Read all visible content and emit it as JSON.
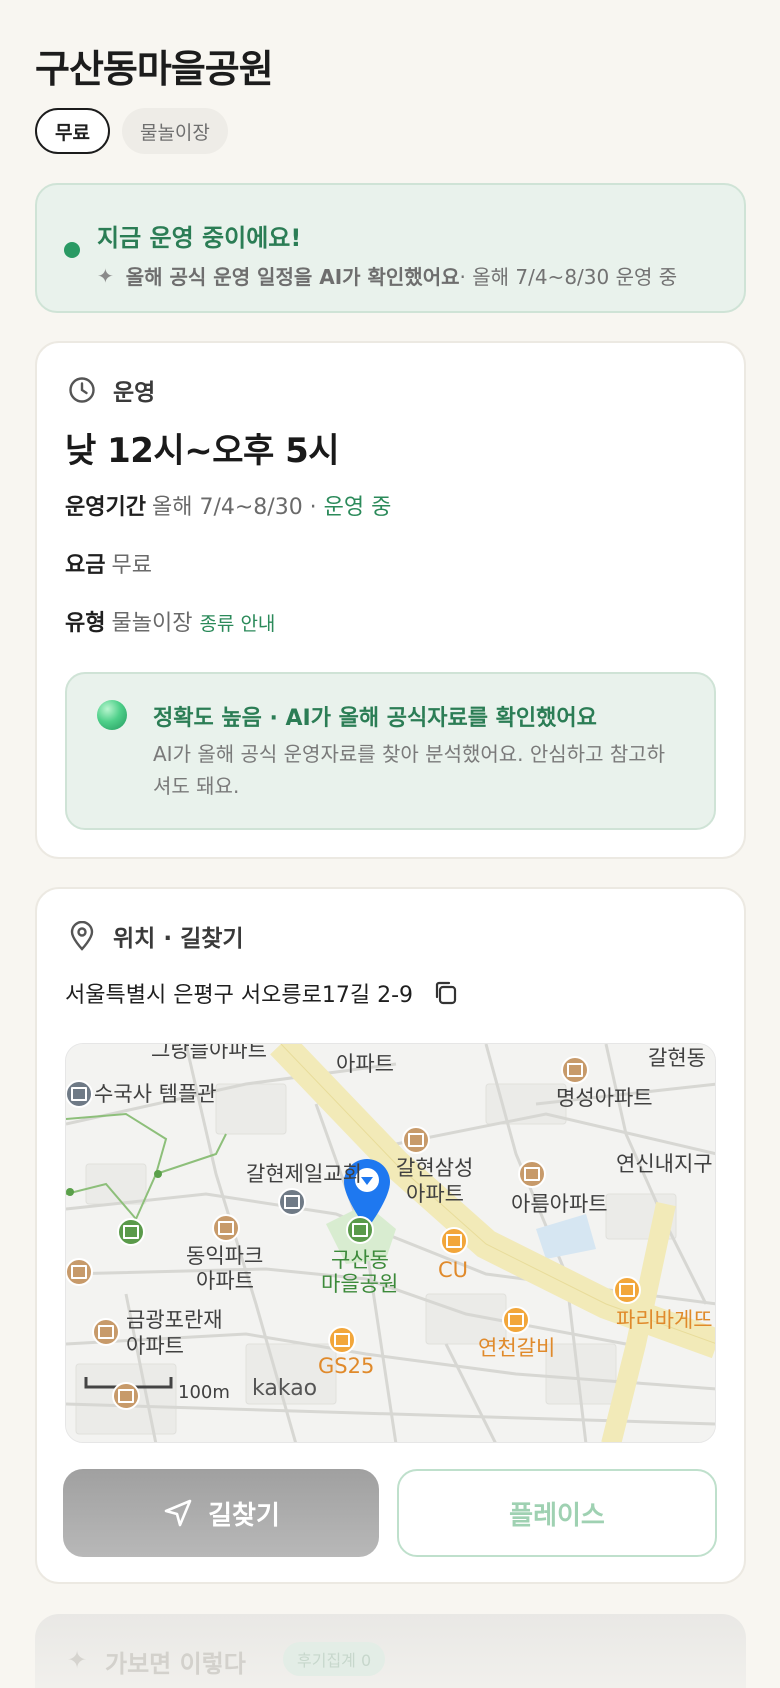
{
  "page": {
    "title": "구산동마을공원",
    "chips": [
      "무료",
      "물놀이장"
    ]
  },
  "status": {
    "headline": "지금 운영 중이에요!",
    "sub_bold": "올해 공식 운영 일정을 AI가 확인했어요",
    "sub_rest": " · 올해 7/4~8/30 운영 중"
  },
  "operation": {
    "section_title": "운영",
    "hours": "낮 12시~오후 5시",
    "period_label": "운영기간",
    "period_value": "올해 7/4~8/30 · ",
    "period_status": "운영 중",
    "fee_label": "요금",
    "fee_value": "무료",
    "type_label": "유형",
    "type_value": "물놀이장",
    "type_link": "종류 안내",
    "ai_title": "정확도 높음 · AI가 올해 공식자료를 확인했어요",
    "ai_desc": "AI가 올해 공식 운영자료를 찾아 분석했어요. 안심하고 참고하셔도 돼요."
  },
  "location": {
    "section_title": "위치 · 길찾기",
    "address": "서울특별시 은평구 서오릉로17길 2-9",
    "map_labels": {
      "top_left_apt": "그랑블아파트",
      "top_mid_apt": "아파트",
      "galhyeon_dong": "갈현동",
      "temple": "수국사 템플관",
      "myeongseong": "명성아파트",
      "yeonsin": "연신내지구",
      "church": "갈현제일교회",
      "samsung": "갈현삼성",
      "samsung2": "아파트",
      "areum": "아름아파트",
      "dongik": "동익파크",
      "dongik2": "아파트",
      "park": "구산동",
      "park2": "마을공원",
      "cu": "CU",
      "paris": "파리바게뜨",
      "geumgwang": "금광포란재",
      "geumgwang2": "아파트",
      "yeoncheon": "연천갈비",
      "gs25": "GS25",
      "scale": "100m",
      "brand": "kakao"
    },
    "nav_button": "길찾기",
    "place_button": "플레이스"
  },
  "next_section": {
    "title": "가보면 이렇다",
    "badge": "후기집계 0"
  },
  "colors": {
    "accent_green": "#2b8a5a",
    "pin_blue": "#1e78f0"
  }
}
